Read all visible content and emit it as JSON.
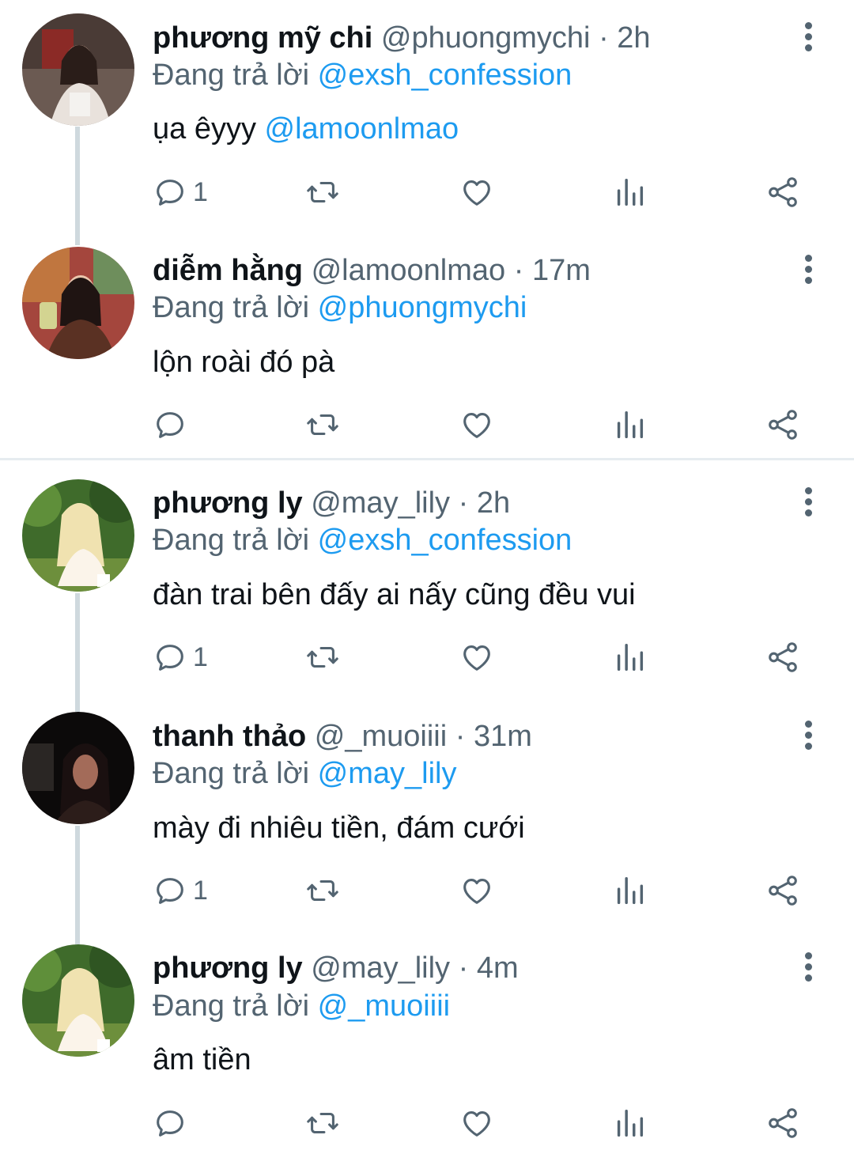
{
  "tweets": [
    {
      "name": "phương mỹ chi",
      "handle": "@phuongmychi",
      "time": "2h",
      "reply_prefix": "Đang trả lời",
      "reply_to": "@exsh_confession",
      "text": "ụa êyyy",
      "text_mention": "@lamoonlmao",
      "reply_count": "1"
    },
    {
      "name": "diễm hằng",
      "handle": "@lamoonlmao",
      "time": "17m",
      "reply_prefix": "Đang trả lời",
      "reply_to": "@phuongmychi",
      "text": "lộn roài đó pà",
      "text_mention": "",
      "reply_count": ""
    },
    {
      "name": "phương ly",
      "handle": "@may_lily",
      "time": "2h",
      "reply_prefix": "Đang trả lời",
      "reply_to": "@exsh_confession",
      "text": "đàn trai bên đấy ai nấy cũng đều vui",
      "text_mention": "",
      "reply_count": "1"
    },
    {
      "name": "thanh thảo",
      "handle": "@_muoiiii",
      "time": "31m",
      "reply_prefix": "Đang trả lời",
      "reply_to": "@may_lily",
      "text": "mày đi nhiêu tiền, đám cưới",
      "text_mention": "",
      "reply_count": "1"
    },
    {
      "name": "phương ly",
      "handle": "@may_lily",
      "time": "4m",
      "reply_prefix": "Đang trả lời",
      "reply_to": "@_muoiiii",
      "text": "âm tiền",
      "text_mention": "",
      "reply_count": ""
    }
  ],
  "separator": "·",
  "colors": {
    "accent": "#1d9bf0",
    "secondary": "#536471",
    "text": "#0f1419",
    "thread_line": "#cfd9de"
  },
  "icons": [
    "reply-icon",
    "retweet-icon",
    "like-icon",
    "views-icon",
    "share-icon",
    "more-icon"
  ]
}
